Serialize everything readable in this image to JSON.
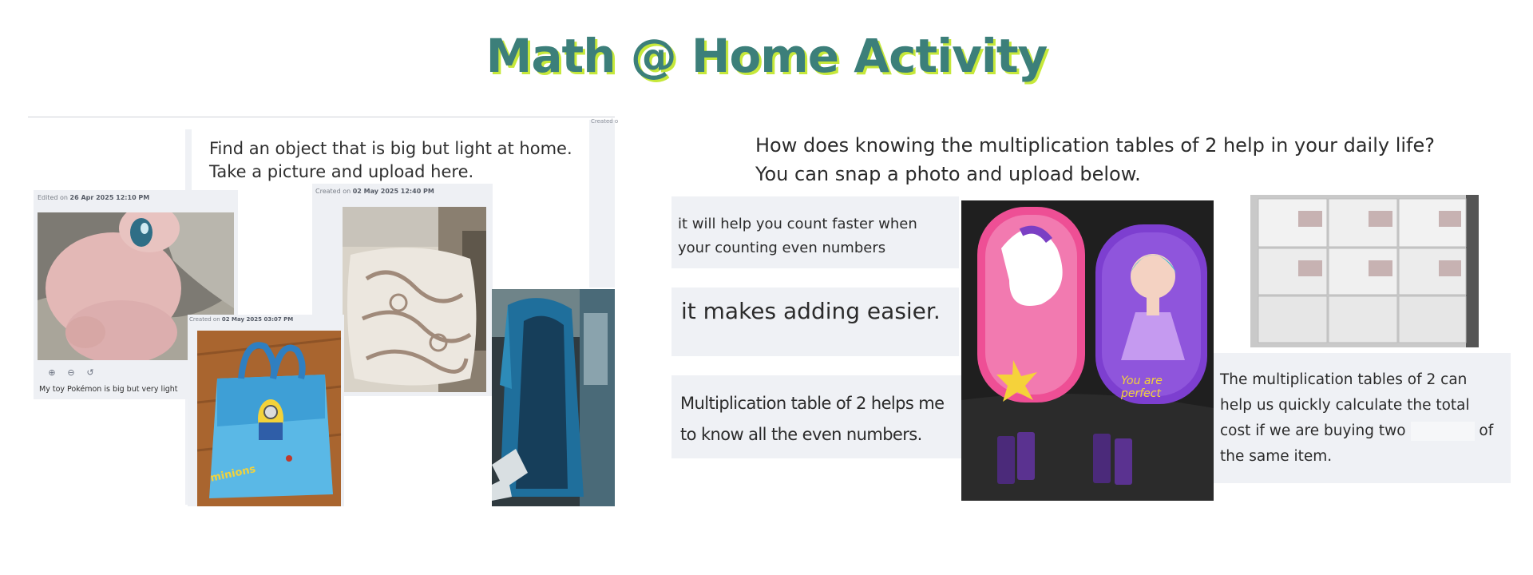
{
  "page": {
    "title": "Math @ Home Activity"
  },
  "left_board": {
    "prompt_line1": "Find an object that is big but light at home.",
    "prompt_line2": "Take a picture and upload here.",
    "corner_meta": "Created o",
    "cards": [
      {
        "meta_prefix": "Edited on ",
        "meta_date": "26 Apr 2025 12:10 PM",
        "photo_desc": "pink plush toy on bed",
        "caption": "My toy Pokémon is big but very light",
        "tools": [
          "zoom-in-icon",
          "zoom-out-icon",
          "reset-icon"
        ]
      },
      {
        "meta_prefix": "Created on ",
        "meta_date": "02 May 2025 12:40 PM",
        "photo_desc": "patterned cushion"
      },
      {
        "meta_prefix": "Created on ",
        "meta_date": "02 May 2025 03:07 PM",
        "photo_desc": "blue minions bag",
        "bag_text": "minions"
      },
      {
        "photo_desc": "blue raincoat"
      }
    ]
  },
  "right_board": {
    "prompt_line1": "How does knowing the multiplication tables of 2 help in your daily life?",
    "prompt_line2": "You can snap a photo and upload below.",
    "answers": [
      {
        "text": "it will help you count faster when your counting even numbers"
      },
      {
        "text": "it makes adding easier."
      },
      {
        "text": "Multiplication  table of 2 helps me to know  all the even numbers."
      },
      {
        "text_before": "The multiplication tables of 2 can help us quickly calculate the total cost if we are buying two",
        "text_after": "of the same item."
      }
    ],
    "photos": [
      {
        "photo_desc": "pencil cases with chocolates",
        "label": "You are perfect"
      },
      {
        "photo_desc": "stack of tissue boxes"
      }
    ]
  },
  "colors": {
    "title": "#3c7f7a",
    "title_shadow": "#c6e83a",
    "panel_bg": "#eff1f5"
  }
}
